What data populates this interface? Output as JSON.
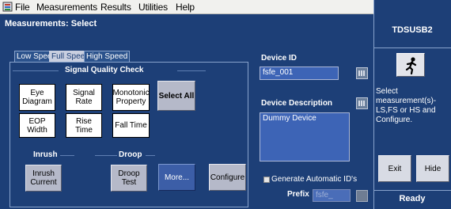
{
  "menu": {
    "items": [
      "File",
      "Measurements",
      "Results",
      "Utilities",
      "Help"
    ]
  },
  "main": {
    "title": "Measurements: Select",
    "tabs": [
      {
        "label": "Low Speed",
        "active": false
      },
      {
        "label": "Full Speed",
        "active": true
      },
      {
        "label": "High Speed",
        "active": false
      }
    ],
    "signal_quality": {
      "title": "Signal Quality Check",
      "buttons": [
        "Eye\nDiagram",
        "Signal\nRate",
        "Monotonic\nProperty",
        "EOP Width",
        "Rise Time",
        "Fall Time"
      ],
      "select_all": "Select All"
    },
    "inrush": {
      "title": "Inrush",
      "button": "Inrush\nCurrent"
    },
    "droop": {
      "title": "Droop",
      "button": "Droop\nTest"
    },
    "more_button": "More...",
    "configure_button": "Configure"
  },
  "device": {
    "id_label": "Device ID",
    "id_value": "fsfe_001",
    "description_label": "Device Description",
    "description_value": "Dummy Device",
    "generate_label": "Generate Automatic ID's",
    "generate_checked": false,
    "prefix_label": "Prefix",
    "prefix_value": "fsfe_"
  },
  "sidebar": {
    "title": "TDSUSB2",
    "help": "Select measurement(s)- LS,FS or HS and Configure.",
    "exit_button": "Exit",
    "hide_button": "Hide",
    "status": "Ready"
  }
}
